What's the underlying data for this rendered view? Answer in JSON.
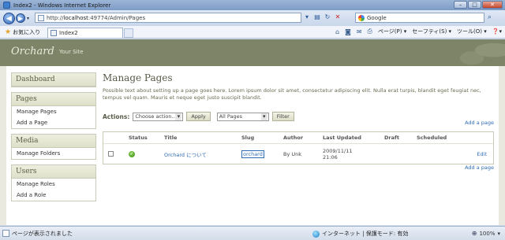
{
  "window": {
    "title": "Index2 - Windows Internet Explorer"
  },
  "address": {
    "url_prefix": "http://",
    "url_host": "localhost",
    "url_rest": ":49774/Admin/Pages"
  },
  "search": {
    "placeholder": "Google"
  },
  "favorites": {
    "label": "お気に入り"
  },
  "tab": {
    "title": "Index2"
  },
  "commands": {
    "page": "ページ(P) ▾",
    "safety": "セーフティ(S) ▾",
    "tools": "ツール(O) ▾",
    "help": "❓▾"
  },
  "site": {
    "logo": "Orchard",
    "name": "Your Site"
  },
  "sidebar": {
    "groups": [
      {
        "title": "Dashboard",
        "items": []
      },
      {
        "title": "Pages",
        "items": [
          "Manage Pages",
          "Add a Page"
        ]
      },
      {
        "title": "Media",
        "items": [
          "Manage Folders"
        ]
      },
      {
        "title": "Users",
        "items": [
          "Manage Roles",
          "Add a Role"
        ]
      }
    ]
  },
  "main": {
    "title": "Manage Pages",
    "intro": "Possible text about setting up a page goes here. Lorem ipsum dolor sit amet, consectetur adipiscing elit. Nulla erat turpis, blandit eget feugiat nec, tempus vel quam. Mauris et neque eget justo suscipit blandit.",
    "actions_label": "Actions:",
    "action_select": "Choose action...",
    "apply": "Apply",
    "filter_select": "All Pages",
    "filter": "Filter",
    "add_page": "Add a page"
  },
  "table": {
    "columns": [
      "",
      "Status",
      "Title",
      "Slug",
      "Author",
      "Last Updated",
      "Draft",
      "Scheduled",
      ""
    ],
    "rows": [
      {
        "title": "Orchard について",
        "slug": "orchard",
        "author": "By Unk",
        "updated_date": "2009/11/11",
        "updated_time": "21:06",
        "draft": "",
        "scheduled": "",
        "action": "Edit"
      }
    ]
  },
  "status": {
    "text": "ページが表示されました",
    "zone": "インターネット | 保護モード: 有効",
    "zoom": "100%"
  }
}
